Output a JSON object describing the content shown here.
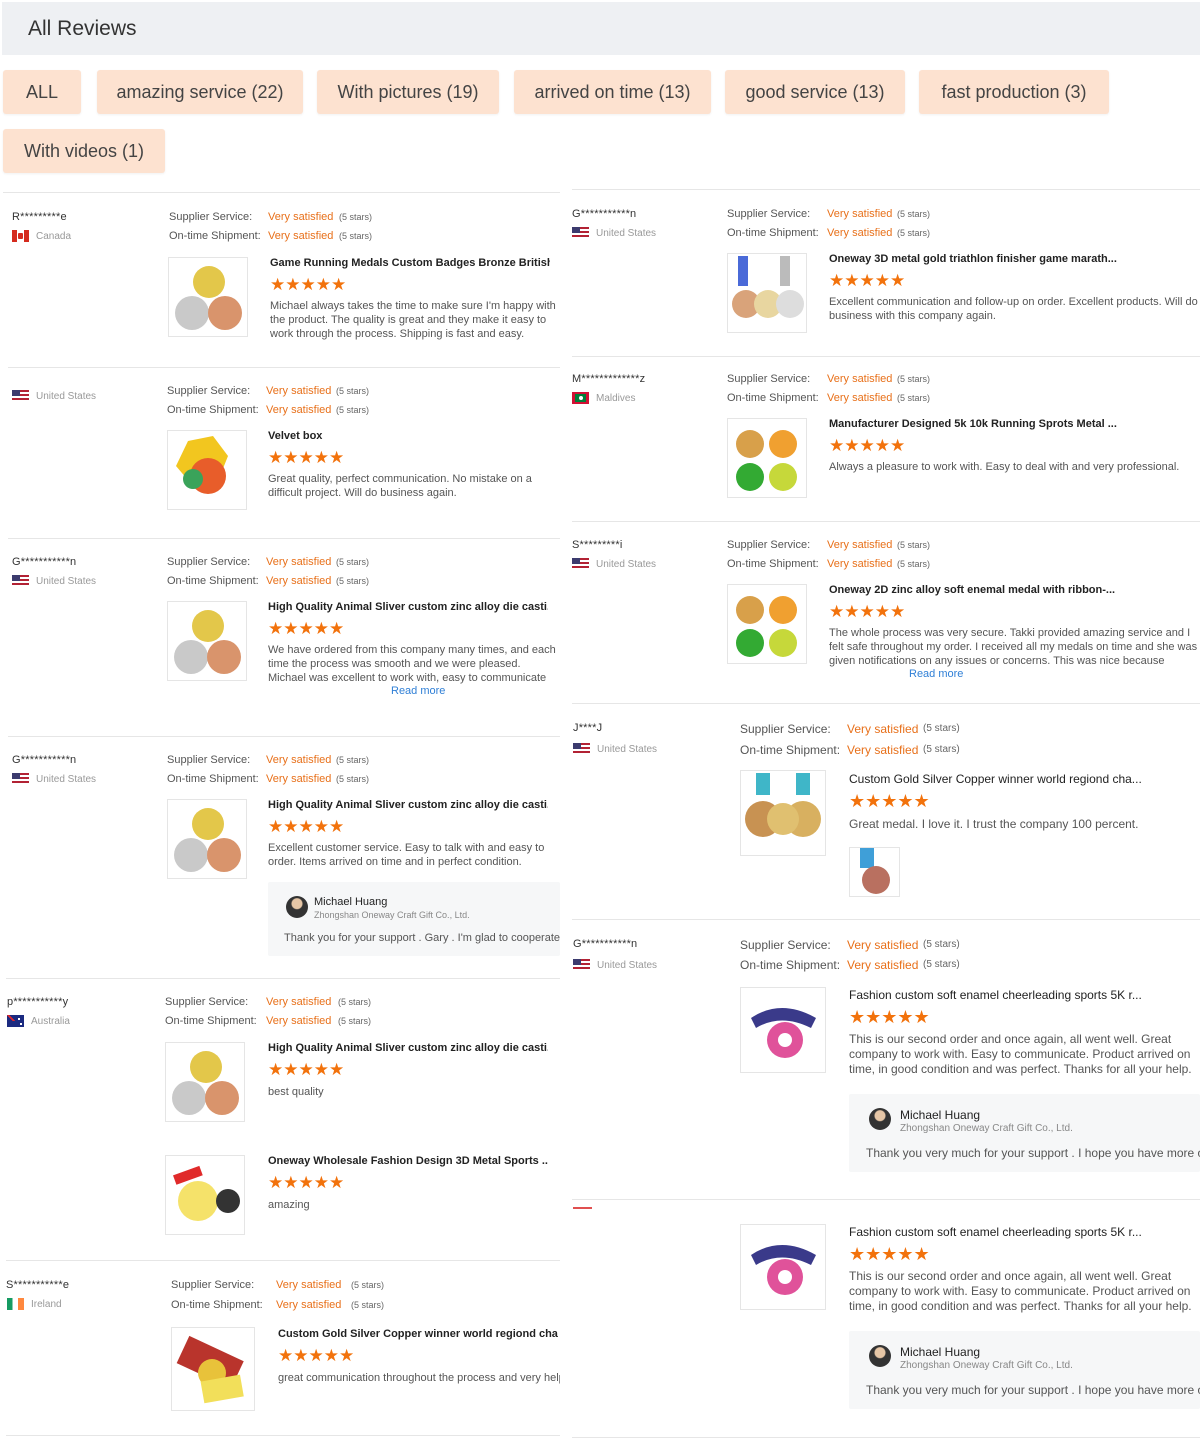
{
  "header": {
    "title": "All Reviews"
  },
  "filters": [
    "ALL",
    "amazing service (22)",
    "With pictures (19)",
    "arrived on time (13)",
    "good service (13)",
    "fast production (3)",
    "With videos (1)"
  ],
  "labels": {
    "supplier_service": "Supplier Service:",
    "ontime_shipment": "On-time Shipment:",
    "very_satisfied": "Very satisfied",
    "five_stars": "(5 stars)",
    "stars": "★★★★★",
    "read_more": "Read more"
  },
  "colors": {
    "accent": "#e8701a",
    "filter_bg": "#fde2d0",
    "star": "#f2720c",
    "link": "#2f7fd6"
  },
  "left_reviews": [
    {
      "name": "R*********e",
      "country": "Canada",
      "flag": "canada-flag",
      "products": [
        {
          "title": "Game Running Medals Custom Badges Bronze British...",
          "text": "Michael always takes the time to make sure I'm happy with the product. The quality is great and they make it easy to work through the process. Shipping is fast and easy."
        }
      ]
    },
    {
      "name": "",
      "country": "United States",
      "flag": "us-flag",
      "products": [
        {
          "title": "Velvet box",
          "text": "Great quality, perfect communication. No mistake on a difficult project. Will do business again."
        }
      ]
    },
    {
      "name": "G***********n",
      "country": "United States",
      "flag": "us-flag",
      "products": [
        {
          "title": "High Quality Animal Sliver custom zinc alloy die casti...",
          "text": "We have ordered from this company many times, and each time the process was smooth and we were pleased. Michael was excellent to work with, easy to communicate with. The medals that we ordered were delivered on time and look great. Very easy to work with...",
          "read_more": true
        }
      ]
    },
    {
      "name": "G***********n",
      "country": "United States",
      "flag": "us-flag",
      "products": [
        {
          "title": "High Quality Animal Sliver custom zinc alloy die casti...",
          "text": "Excellent customer service. Easy to talk with and easy to order. Items arrived on time and in perfect condition. Thanks!"
        }
      ],
      "reply": {
        "name": "Michael Huang",
        "company": "Zhongshan Oneway Craft Gift Co., Ltd.",
        "text": "Thank you for your support . Gary . I'm glad to cooperate with you."
      }
    },
    {
      "name": "p***********y",
      "country": "Australia",
      "flag": "australia-flag",
      "products": [
        {
          "title": "High Quality Animal Sliver custom zinc alloy die casti...",
          "text": "best quality"
        },
        {
          "title": "Oneway Wholesale Fashion Design 3D Metal Sports ...",
          "text": "amazing"
        }
      ]
    },
    {
      "name": "S***********e",
      "country": "Ireland",
      "flag": "ireland-flag",
      "products": [
        {
          "title": "Custom Gold Silver Copper winner world regiond cha...",
          "text": "great communication throughout the process and very helpful."
        }
      ]
    }
  ],
  "right_reviews": [
    {
      "name": "G***********n",
      "country": "United States",
      "flag": "us-flag",
      "products": [
        {
          "title": "Oneway 3D metal gold triathlon finisher game marath...",
          "text": "Excellent communication and follow-up on order. Excellent products. Will do business with this company again."
        }
      ]
    },
    {
      "name": "M*************z",
      "country": "Maldives",
      "flag": "maldives-flag",
      "products": [
        {
          "title": "Manufacturer Designed 5k 10k Running Sprots Metal ...",
          "text": "Always a pleasure to work with. Easy to deal with and  very professional."
        }
      ]
    },
    {
      "name": "S*********i",
      "country": "United States",
      "flag": "us-flag",
      "products": [
        {
          "title": "Oneway 2D zinc alloy soft enemal medal with ribbon-...",
          "text": "The whole process was very secure. Takki provided amazing service and I felt safe throughout my order. I received all my medals on time and she was given notifications on any issues or concerns. This was nice because shipping overseas is a little chaotic right now. She is a tr...",
          "read_more": true
        }
      ]
    },
    {
      "name": "J****J",
      "country": "United States",
      "flag": "us-flag",
      "products": [
        {
          "title": "Custom Gold Silver Copper winner world regiond cha...",
          "text": "Great medal. I love it. I trust the company 100 percent."
        }
      ]
    },
    {
      "name": "G***********n",
      "country": "United States",
      "flag": "us-flag",
      "products": [
        {
          "title": "Fashion custom soft enamel cheerleading sports 5K r...",
          "text": "This is our second order and once again, all went well. Great company to work with. Easy to communicate. Product arrived on time, in good condition and was perfect. Thanks for all your help."
        }
      ],
      "reply": {
        "name": "Michael Huang",
        "company": "Zhongshan Oneway Craft Gift Co., Ltd.",
        "text": "Thank you very much for your support . I hope you have more orders ."
      }
    },
    {
      "name": "",
      "country": "",
      "flag": "",
      "products": [
        {
          "title": "Fashion custom soft enamel cheerleading sports 5K r...",
          "text": "This is our second order and once again, all went well. Great company to work with. Easy to communicate. Product arrived on time, in good condition and was perfect. Thanks for all your help."
        }
      ],
      "reply": {
        "name": "Michael Huang",
        "company": "Zhongshan Oneway Craft Gift Co., Ltd.",
        "text": "Thank you very much for your support . I hope you have more orders ."
      }
    }
  ]
}
